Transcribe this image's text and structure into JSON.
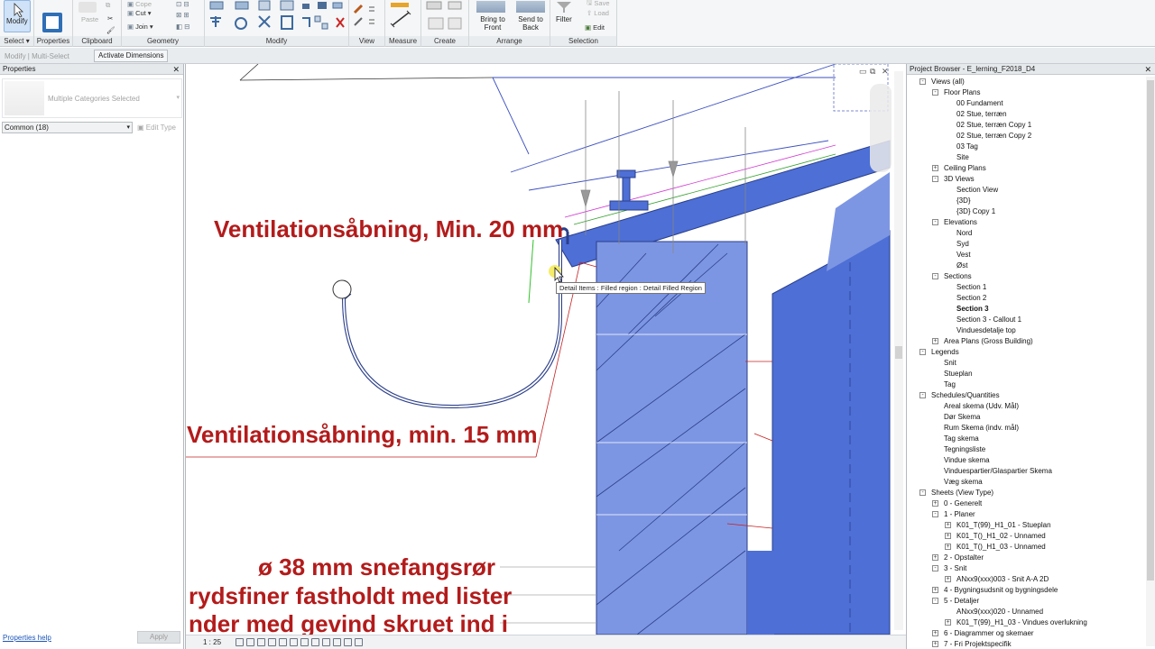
{
  "ribbon": {
    "panels": [
      "Select",
      "Properties",
      "Clipboard",
      "Geometry",
      "Modify",
      "View",
      "Measure",
      "Create",
      "Arrange",
      "Selection"
    ],
    "modify_label": "Modify",
    "select_label": "Select",
    "properties_label": "Properties",
    "paste_label": "Paste",
    "cut_label": "Cut",
    "copy_label": "Cope",
    "join_label": "Join",
    "bring_front_label": "Bring to Front",
    "send_back_label": "Send to Back",
    "filter_label": "Filter",
    "save_label": "Save",
    "load_label": "Load",
    "edit_label": "Edit"
  },
  "options_bar": {
    "context": "Modify | Multi-Select",
    "activate_dimensions": "Activate Dimensions"
  },
  "properties": {
    "title": "Properties",
    "type_selector": "Multiple Categories Selected",
    "filter": "Common (18)",
    "edit_type": "Edit Type",
    "help_link": "Properties help",
    "apply": "Apply"
  },
  "view": {
    "annotations": [
      "Ventilationsåbning, Min. 20 mm",
      "Ventilationsåbning, min. 15 mm",
      "ø 38 mm snefangsrør",
      "rydsfiner fastholdt med lister",
      "nder med gevind skruet ind i"
    ],
    "tooltip": "Detail Items : Filled region : Detail Filled Region",
    "scale": "1 : 25",
    "fill_color": "#4d6fd6",
    "fill_color_light": "#7d96e3"
  },
  "browser": {
    "title": "Project Browser - E_lerning_F2018_D4",
    "items": [
      {
        "label": "Views (all)",
        "level": 0,
        "toggle": "-"
      },
      {
        "label": "Floor Plans",
        "level": 1,
        "toggle": "-"
      },
      {
        "label": "00 Fundament",
        "level": 2
      },
      {
        "label": "02 Stue, terræn",
        "level": 2
      },
      {
        "label": "02 Stue, terræn Copy 1",
        "level": 2
      },
      {
        "label": "02 Stue, terræn Copy 2",
        "level": 2
      },
      {
        "label": "03 Tag",
        "level": 2
      },
      {
        "label": "Site",
        "level": 2
      },
      {
        "label": "Ceiling Plans",
        "level": 1,
        "toggle": "+"
      },
      {
        "label": "3D Views",
        "level": 1,
        "toggle": "-"
      },
      {
        "label": "Section View",
        "level": 2
      },
      {
        "label": "{3D}",
        "level": 2
      },
      {
        "label": "{3D} Copy 1",
        "level": 2
      },
      {
        "label": "Elevations",
        "level": 1,
        "toggle": "-"
      },
      {
        "label": "Nord",
        "level": 2
      },
      {
        "label": "Syd",
        "level": 2
      },
      {
        "label": "Vest",
        "level": 2
      },
      {
        "label": "Øst",
        "level": 2
      },
      {
        "label": "Sections",
        "level": 1,
        "toggle": "-"
      },
      {
        "label": "Section 1",
        "level": 2
      },
      {
        "label": "Section 2",
        "level": 2
      },
      {
        "label": "Section 3",
        "level": 2,
        "bold": true
      },
      {
        "label": "Section 3 - Callout 1",
        "level": 2
      },
      {
        "label": "Vinduesdetalje top",
        "level": 2
      },
      {
        "label": "Area Plans (Gross Building)",
        "level": 1,
        "toggle": "+"
      },
      {
        "label": "Legends",
        "level": 0,
        "toggle": "-"
      },
      {
        "label": "Snit",
        "level": 1
      },
      {
        "label": "Stueplan",
        "level": 1
      },
      {
        "label": "Tag",
        "level": 1
      },
      {
        "label": "Schedules/Quantities",
        "level": 0,
        "toggle": "-"
      },
      {
        "label": "Areal skema (Udv. Mål)",
        "level": 1
      },
      {
        "label": "Dør Skema",
        "level": 1
      },
      {
        "label": "Rum Skema (indv. mål)",
        "level": 1
      },
      {
        "label": "Tag skema",
        "level": 1
      },
      {
        "label": "Tegningsliste",
        "level": 1
      },
      {
        "label": "Vindue skema",
        "level": 1
      },
      {
        "label": "Vinduespartier/Glaspartier Skema",
        "level": 1
      },
      {
        "label": "Væg skema",
        "level": 1
      },
      {
        "label": "Sheets (View Type)",
        "level": 0,
        "toggle": "-"
      },
      {
        "label": "0 - Generelt",
        "level": 1,
        "toggle": "+"
      },
      {
        "label": "1 - Planer",
        "level": 1,
        "toggle": "-"
      },
      {
        "label": "K01_T(99)_H1_01 - Stueplan",
        "level": 2,
        "toggle": "+"
      },
      {
        "label": "K01_T()_H1_02 - Unnamed",
        "level": 2,
        "toggle": "+"
      },
      {
        "label": "K01_T()_H1_03 - Unnamed",
        "level": 2,
        "toggle": "+"
      },
      {
        "label": "2 - Opstalter",
        "level": 1,
        "toggle": "+"
      },
      {
        "label": "3 - Snit",
        "level": 1,
        "toggle": "-"
      },
      {
        "label": "ANxx9(xxx)003 - Snit A-A 2D",
        "level": 2,
        "toggle": "+"
      },
      {
        "label": "4 - Bygningsudsnit og bygningsdele",
        "level": 1,
        "toggle": "+"
      },
      {
        "label": "5 - Detaljer",
        "level": 1,
        "toggle": "-"
      },
      {
        "label": "ANxx9(xxx)020 - Unnamed",
        "level": 2
      },
      {
        "label": "K01_T(99)_H1_03 - Vindues overlukning",
        "level": 2,
        "toggle": "+"
      },
      {
        "label": "6 - Diagrammer og skemaer",
        "level": 1,
        "toggle": "+"
      },
      {
        "label": "7 - Fri Projektspecifik",
        "level": 1,
        "toggle": "+"
      }
    ]
  }
}
